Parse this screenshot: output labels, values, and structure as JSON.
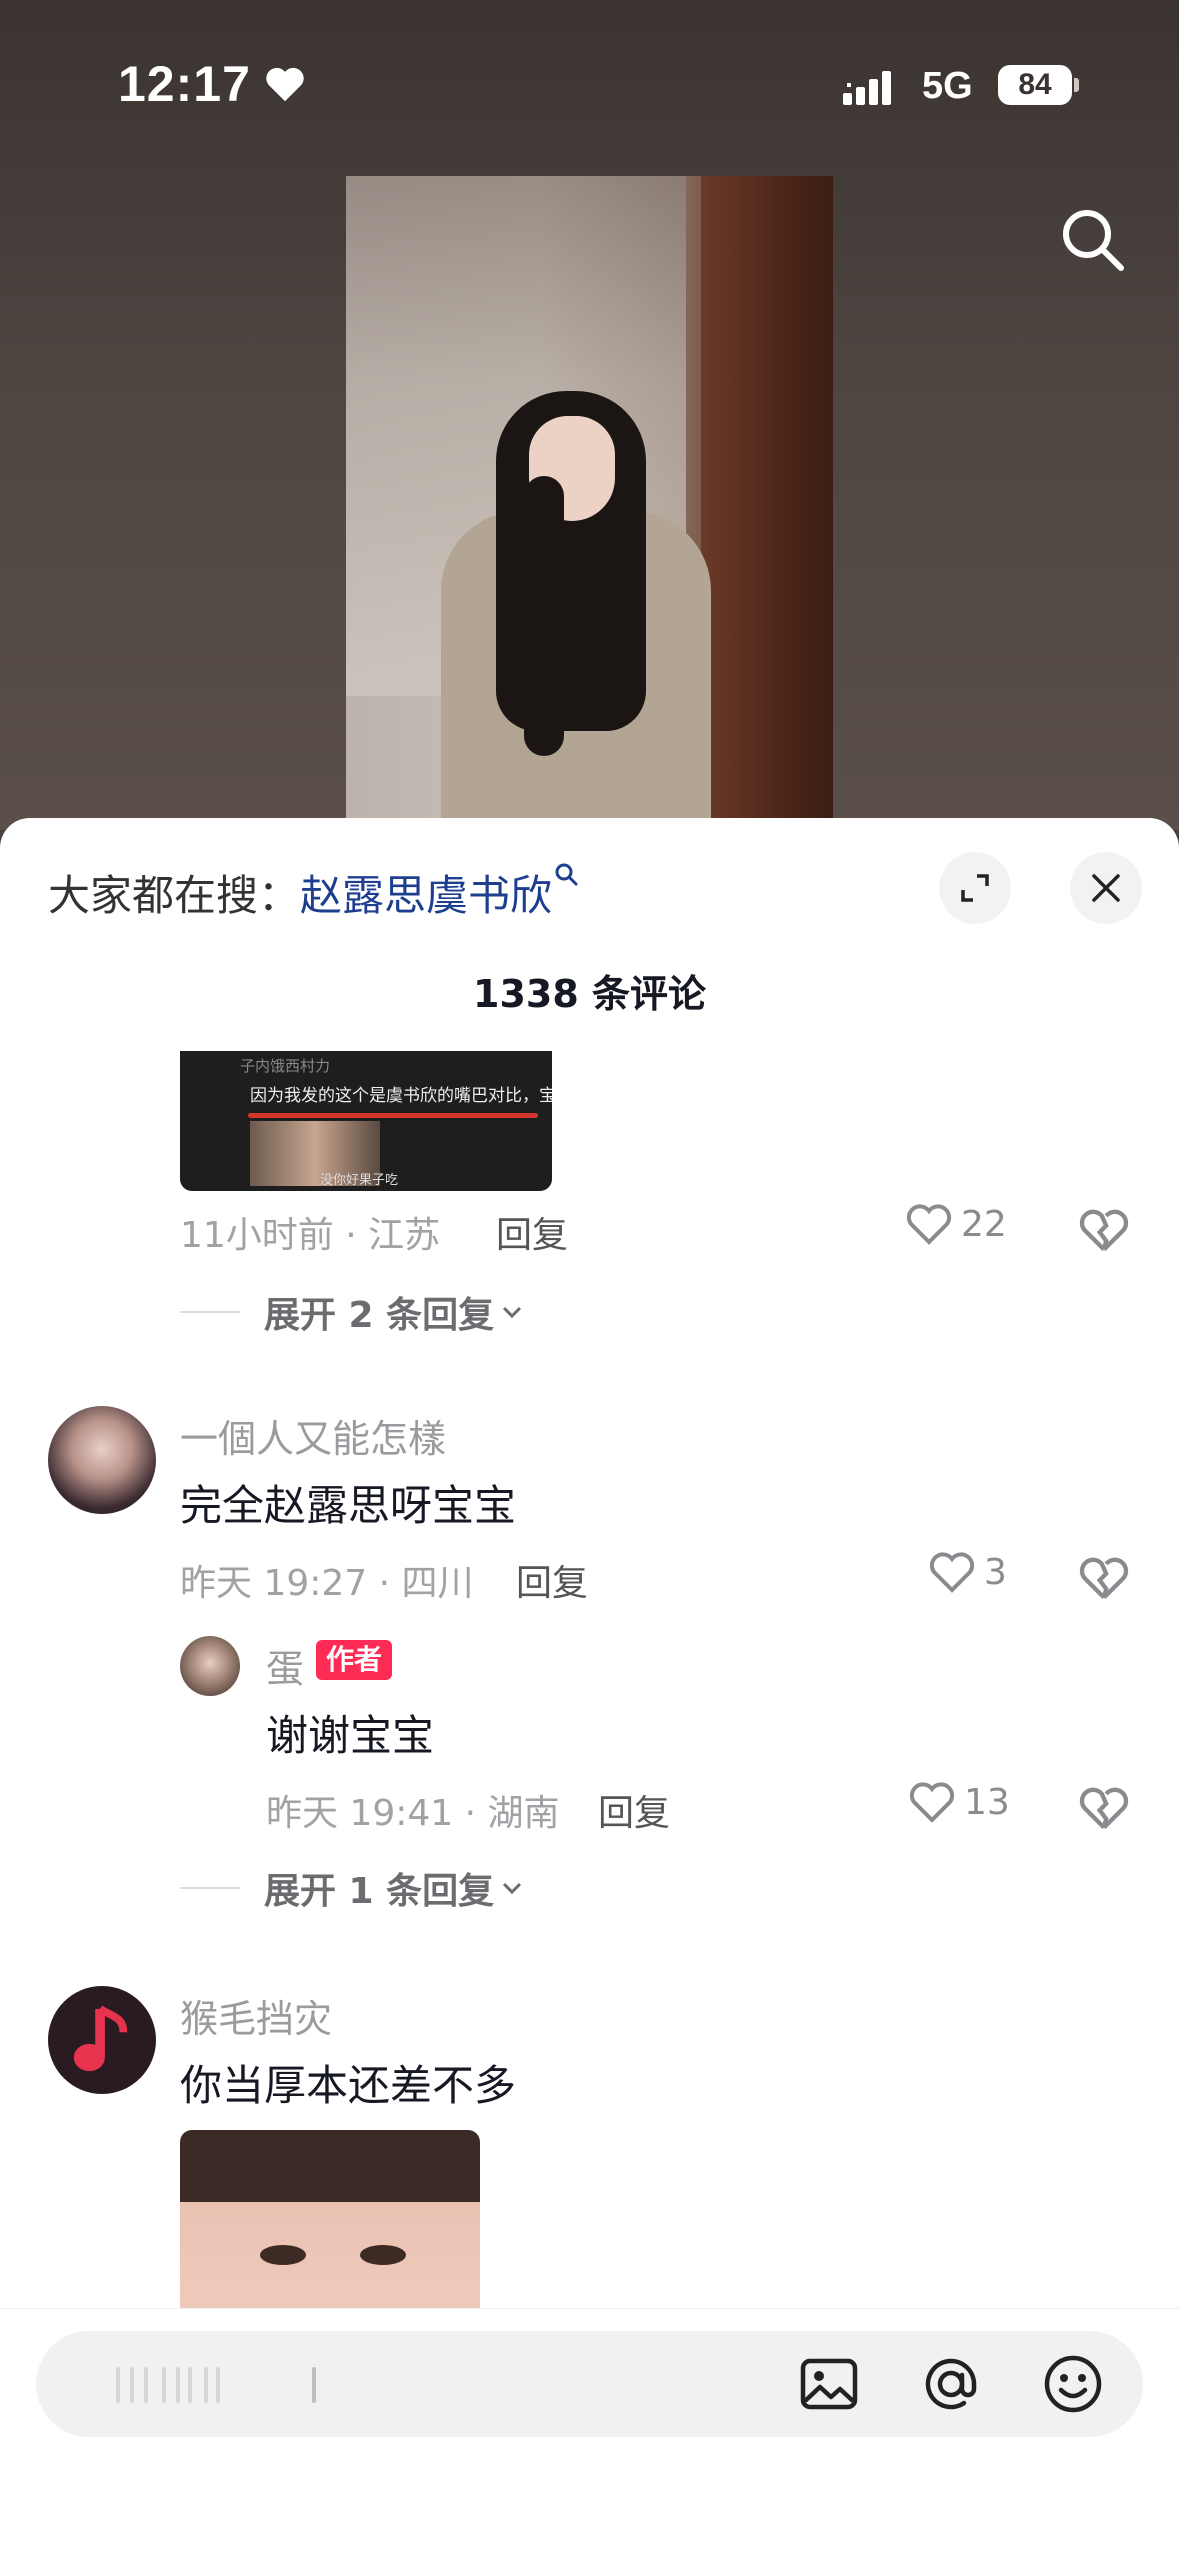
{
  "status_bar": {
    "time": "12:17",
    "network": "5G",
    "battery": "84"
  },
  "sheet": {
    "hot_search_prefix": "大家都在搜：",
    "hot_search_keyword": "赵露思虞书欣",
    "comment_count": "1338 条评论"
  },
  "comments": [
    {
      "image_text_top": "子内饿西村力",
      "image_text": "因为我发的这个是虞书欣的嘴巴对比，宝子",
      "image_caption": "没你好果子吃",
      "meta": "11小时前 · 江苏",
      "reply": "回复",
      "likes": "22",
      "expand": "展开 2 条回复"
    },
    {
      "username": "一個人又能怎樣",
      "text": "完全赵露思呀宝宝",
      "meta": "昨天 19:27 · 四川",
      "reply": "回复",
      "likes": "3",
      "sub_reply": {
        "username": "蛋",
        "tag": "作者",
        "text": "谢谢宝宝",
        "meta": "昨天 19:41 · 湖南",
        "reply": "回复",
        "likes": "13"
      },
      "expand": "展开 1 条回复"
    },
    {
      "username": "猴毛挡灾",
      "text": "你当厚本还差不多"
    }
  ],
  "colors": {
    "accent_red": "#fe2c55",
    "keyword_blue": "#1e3f8f"
  }
}
